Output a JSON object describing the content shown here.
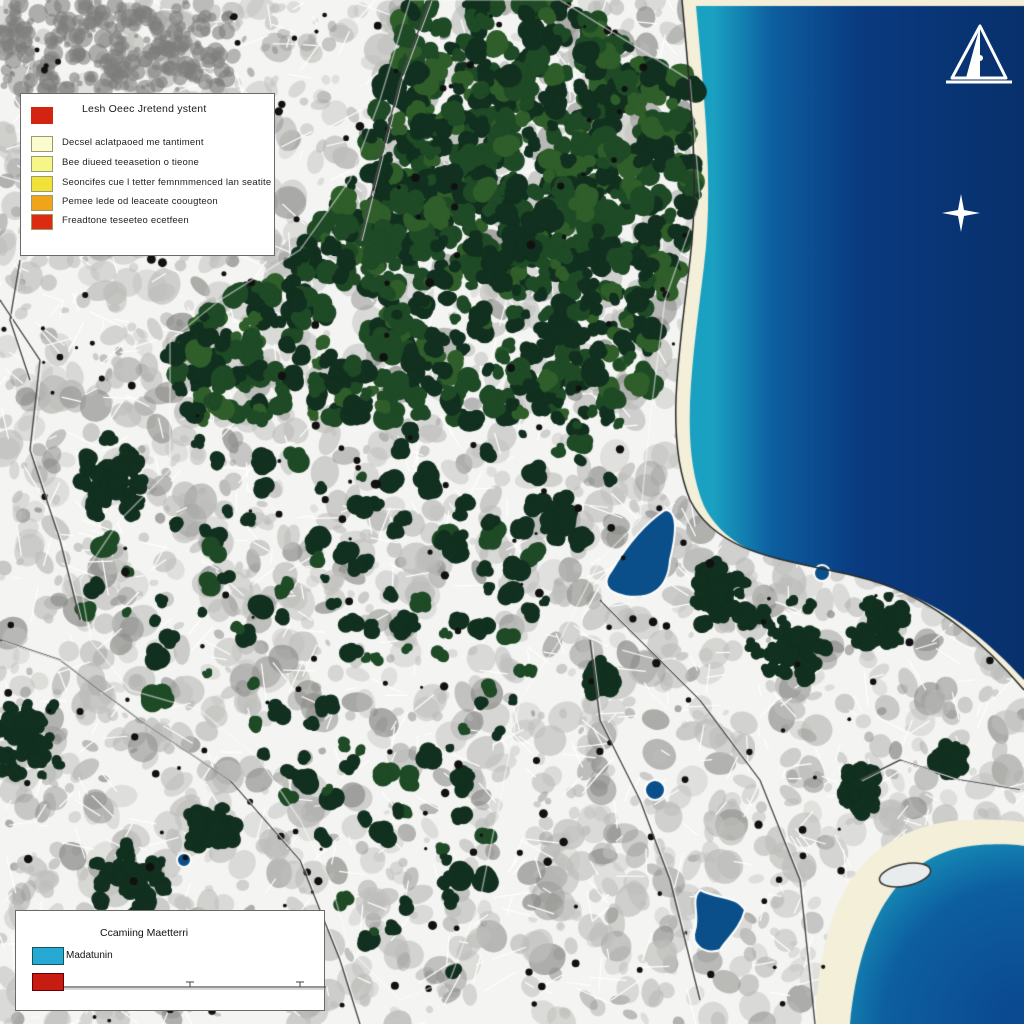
{
  "map": {
    "colors": {
      "land": "#f4f4f2",
      "urban_gray": "#bdbdbb",
      "urban_dark": "#8d8d8b",
      "forest_dark": "#12301f",
      "forest_mid": "#1f4a26",
      "forest_light": "#2f5e2a",
      "ocean_deep": "#0a3a80",
      "ocean_mid": "#0d5fa0",
      "ocean_shallow": "#1aa0c0",
      "beach": "#f3efd8",
      "lake": "#0a4f8a",
      "road": "#4a4a4a"
    },
    "features": [
      "forest-canopy",
      "urban-area",
      "coastline",
      "ocean",
      "beach",
      "lakes",
      "roads"
    ]
  },
  "legend_top": {
    "title": "Lesh Oeec Jretend ystent",
    "items": [
      {
        "label": "Decsel aclatpaoed me tantiment",
        "color": "#fbfbd0"
      },
      {
        "label": "Bee diueed teeasetion o tieone",
        "color": "#f5f58a"
      },
      {
        "label": "Seoncifes cue l tetter femnmmenced lan seatite",
        "color": "#f1e23a"
      },
      {
        "label": "Pemee lede od leaceate coougteon",
        "color": "#f0a419"
      },
      {
        "label": "Freadtone teseeteo ecetfeen",
        "color": "#dd2b12"
      }
    ],
    "header_swatch_color": "#d32412"
  },
  "legend_bottom": {
    "title": "Ccamiing Maetterri",
    "item_label": "Madatunin",
    "item_color": "#27a9d6",
    "bar_color": "#c81b12"
  },
  "icons": {
    "north_arrow": "compass-north-icon",
    "star": "star-icon"
  }
}
